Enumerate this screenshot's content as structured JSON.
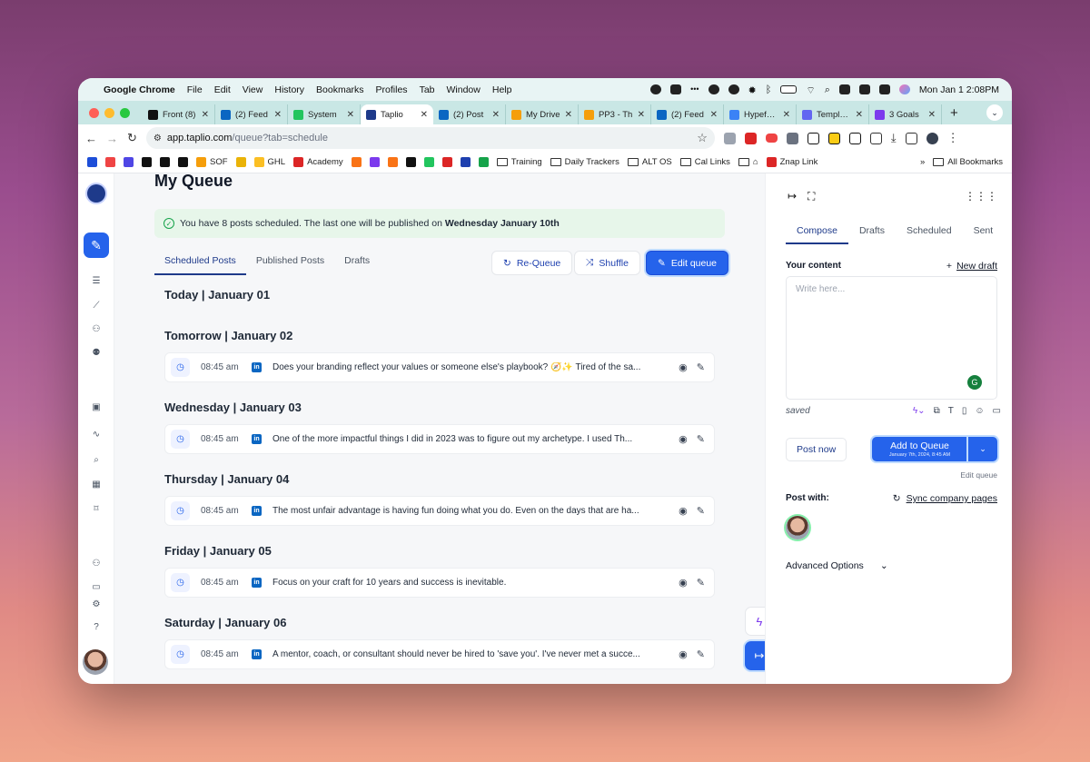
{
  "menubar": {
    "apple": "",
    "app": "Google Chrome",
    "items": [
      "File",
      "Edit",
      "View",
      "History",
      "Bookmarks",
      "Profiles",
      "Tab",
      "Window",
      "Help"
    ],
    "datetime": "Mon Jan 1  2:08PM"
  },
  "tabs": [
    {
      "title": "Front (8)",
      "color": "#111"
    },
    {
      "title": "(2) Feed",
      "color": "#0a66c2"
    },
    {
      "title": "System",
      "color": "#22c55e"
    },
    {
      "title": "Taplio",
      "color": "#1e3a8a",
      "active": true
    },
    {
      "title": "(2) Post",
      "color": "#0a66c2"
    },
    {
      "title": "My Drive",
      "color": "#f59e0b"
    },
    {
      "title": "PP3 - Th",
      "color": "#f59e0b"
    },
    {
      "title": "(2) Feed",
      "color": "#0a66c2"
    },
    {
      "title": "Hypefury",
      "color": "#3b82f6"
    },
    {
      "title": "Template",
      "color": "#6366f1"
    },
    {
      "title": "3 Goals",
      "color": "#7c3aed"
    }
  ],
  "url": {
    "host": "app.taplio.com",
    "path": "/queue?tab=schedule"
  },
  "bookmarks": [
    {
      "label": "",
      "color": "#1d4ed8"
    },
    {
      "label": "",
      "color": "#ef4444"
    },
    {
      "label": "",
      "color": "#4f46e5"
    },
    {
      "label": "",
      "color": "#111"
    },
    {
      "label": "",
      "color": "#111"
    },
    {
      "label": "",
      "color": "#111"
    },
    {
      "label": "SOF",
      "color": "#f59e0b"
    },
    {
      "label": "",
      "color": "#eab308"
    },
    {
      "label": "GHL",
      "color": "#fbbf24"
    },
    {
      "label": "Academy",
      "color": "#dc2626"
    },
    {
      "label": "",
      "color": "#f97316"
    },
    {
      "label": "",
      "color": "#7c3aed"
    },
    {
      "label": "",
      "color": "#f97316"
    },
    {
      "label": "",
      "color": "#111"
    },
    {
      "label": "",
      "color": "#22c55e"
    },
    {
      "label": "",
      "color": "#dc2626"
    },
    {
      "label": "",
      "color": "#1e40af"
    },
    {
      "label": "",
      "color": "#16a34a"
    }
  ],
  "bookmark_folders": [
    "Training",
    "Daily Trackers",
    "ALT OS",
    "Cal Links"
  ],
  "znap": "Znap Link",
  "all_bookmarks": "All Bookmarks",
  "page": {
    "title": "My Queue",
    "banner_pre": "You have 8 posts scheduled. The last one will be published on ",
    "banner_bold": "Wednesday January 10th",
    "subtabs": [
      "Scheduled Posts",
      "Published Posts",
      "Drafts"
    ],
    "requeue": "Re-Queue",
    "shuffle": "Shuffle",
    "edit_queue": "Edit queue"
  },
  "schedule": [
    {
      "day": "Today | January 01",
      "posts": []
    },
    {
      "day": "Tomorrow | January 02",
      "posts": [
        {
          "time": "08:45 am",
          "text": "Does your branding reflect your values or someone else's playbook? 🧭✨ Tired of the sa..."
        }
      ]
    },
    {
      "day": "Wednesday | January 03",
      "posts": [
        {
          "time": "08:45 am",
          "text": "One of the more impactful things I did in 2023 was to figure out my archetype. I used Th..."
        }
      ]
    },
    {
      "day": "Thursday | January 04",
      "posts": [
        {
          "time": "08:45 am",
          "text": "The most unfair advantage is having fun doing what you do. Even on the days that are ha..."
        }
      ]
    },
    {
      "day": "Friday | January 05",
      "posts": [
        {
          "time": "08:45 am",
          "text": "Focus on your craft for 10 years and success is inevitable."
        }
      ]
    },
    {
      "day": "Saturday | January 06",
      "posts": [
        {
          "time": "08:45 am",
          "text": "A mentor, coach, or consultant should never be hired to 'save you'. I've never met a succe..."
        }
      ]
    }
  ],
  "right": {
    "tabs": [
      "Compose",
      "Drafts",
      "Scheduled",
      "Sent"
    ],
    "your_content": "Your content",
    "new_draft": "New draft",
    "placeholder": "Write here...",
    "saved": "saved",
    "post_now": "Post now",
    "add_to_queue": "Add to Queue",
    "add_sub": "January 7th, 2024, 8:45 AM",
    "edit_queue": "Edit queue",
    "post_with": "Post with:",
    "sync": "Sync company pages",
    "advanced": "Advanced Options"
  }
}
